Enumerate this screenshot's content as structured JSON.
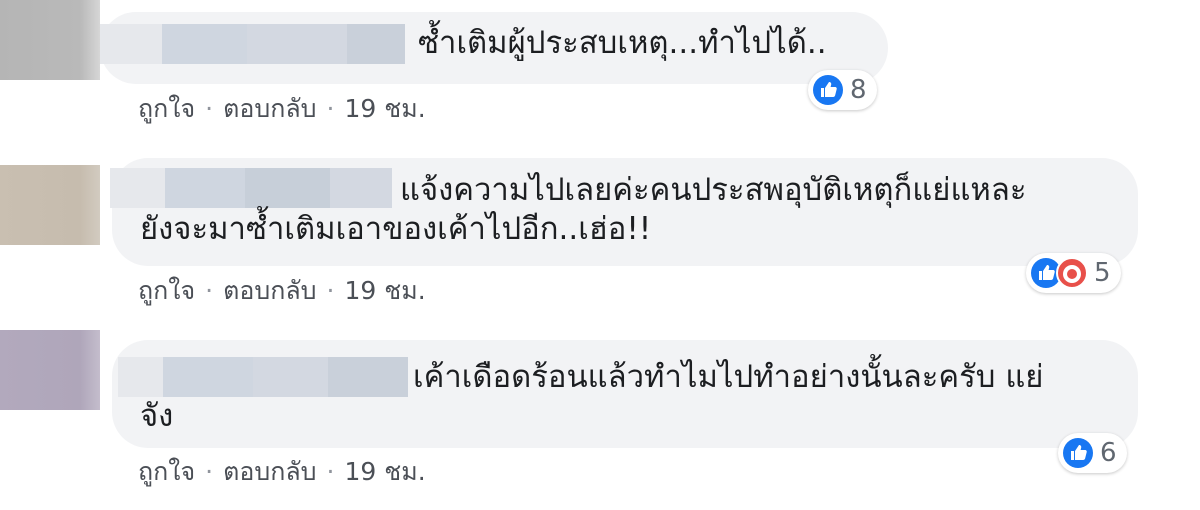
{
  "comments": [
    {
      "text_lines": [
        "ซ้ำเติมผู้ประสบเหตุ...ทำไปได้.."
      ],
      "actions": {
        "like": "ถูกใจ",
        "reply": "ตอบกลับ",
        "time": "19 ชม."
      },
      "reactions": {
        "icons": [
          "like-icon"
        ],
        "count": "8"
      }
    },
    {
      "text_lines": [
        "แจ้งความไปเลยค่ะคนประสพอุบัติเหตุก็แย่แหละ",
        "ยังจะมาซ้ำเติมเอาของเค้าไปอีก..เฮ่อ!!"
      ],
      "actions": {
        "like": "ถูกใจ",
        "reply": "ตอบกลับ",
        "time": "19 ชม."
      },
      "reactions": {
        "icons": [
          "like-icon",
          "angry-icon"
        ],
        "count": "5"
      }
    },
    {
      "text_lines": [
        "เค้าเดือดร้อนแล้วทำไมไปทำอย่างนั้นละครับ แย่",
        "จัง"
      ],
      "actions": {
        "like": "ถูกใจ",
        "reply": "ตอบกลับ",
        "time": "19 ชม."
      },
      "reactions": {
        "icons": [
          "like-icon"
        ],
        "count": "6"
      }
    }
  ],
  "colors": {
    "bubble": "#f2f3f5",
    "like_blue": "#1877f2",
    "angry_red": "#e8504a",
    "meta_text": "#4b4f56"
  }
}
